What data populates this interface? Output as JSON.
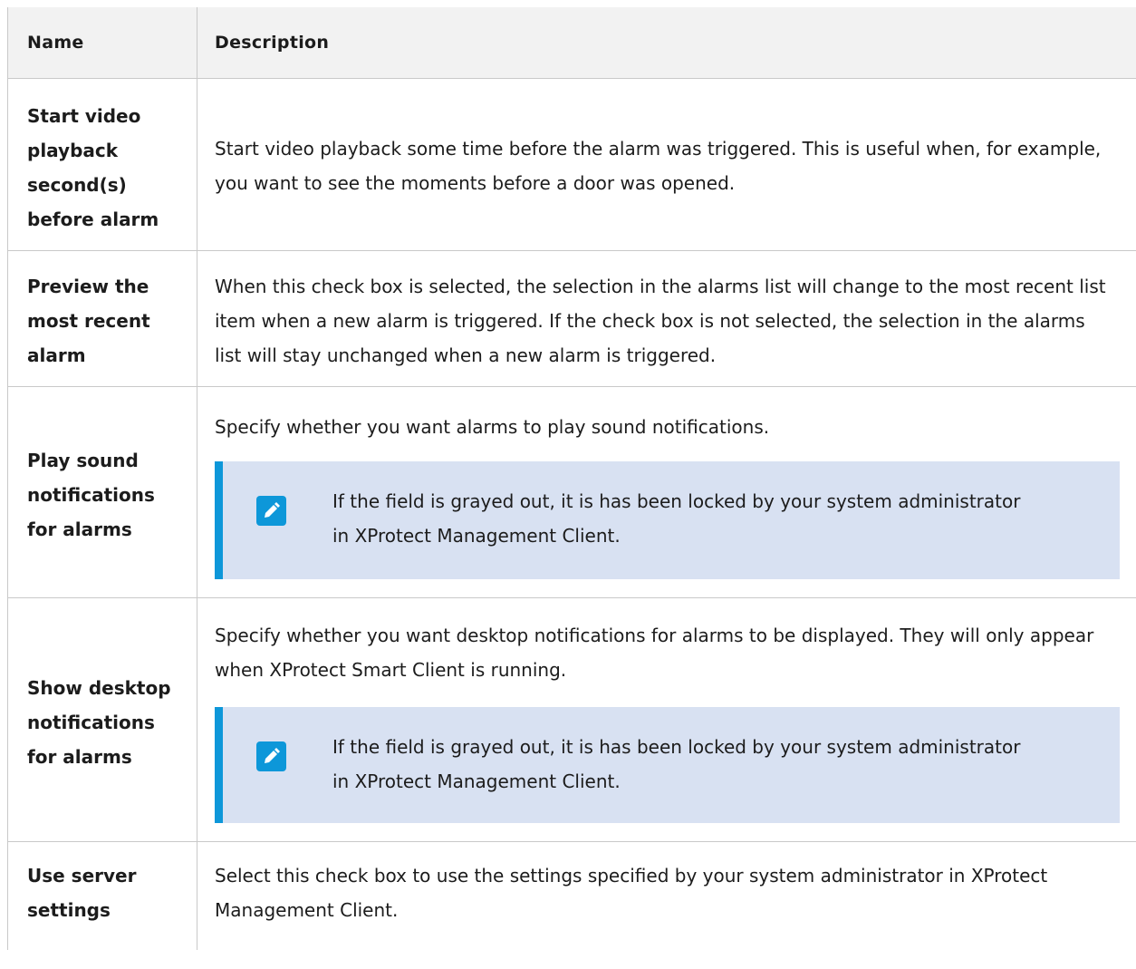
{
  "table": {
    "header": {
      "name": "Name",
      "description": "Description"
    },
    "rows": [
      {
        "name": "Start video playback second(s) before alarm",
        "description": "Start video playback some time before the alarm was triggered. This is useful when, for example, you want to see the moments before a door was opened."
      },
      {
        "name": "Preview the most recent alarm",
        "description": "When this check box is selected, the selection in the alarms list will change to the most recent list item when a new alarm is triggered. If the check box is not selected, the selection in the alarms list will stay unchanged when a new alarm is triggered."
      },
      {
        "name": "Play sound notifications for alarms",
        "description": "Specify whether you want alarms to play sound notifications.",
        "note": "If the field is grayed out, it is has been locked by your system administrator in XProtect Management Client.",
        "note_icon": "pencil-icon"
      },
      {
        "name": "Show desktop notifications for alarms",
        "description": "Specify whether you want desktop notifications for alarms to be displayed. They will only appear when XProtect Smart Client is running.",
        "note": "If the field is grayed out, it is has been locked by your system administrator in XProtect Management Client.",
        "note_icon": "pencil-icon"
      },
      {
        "name": "Use server settings",
        "description": "Select this check box to use the settings specified by your system administrator in XProtect Management Client."
      }
    ]
  },
  "colors": {
    "note_background": "#d8e1f2",
    "note_accent": "#0d97d9",
    "header_background": "#f2f2f2"
  }
}
